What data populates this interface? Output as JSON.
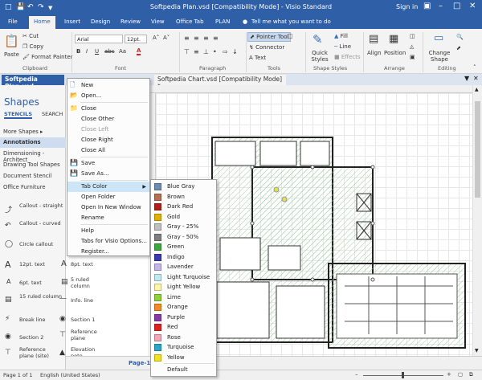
{
  "titlebar": {
    "title": "Softpedia Plan.vsd  [Compatibility Mode] - Visio Standard",
    "signin": "Sign in",
    "save_icon": "save-icon",
    "undo_icon": "undo-icon",
    "redo_icon": "redo-icon",
    "minimize_icon": "minimize-icon",
    "restore_icon": "restore-icon",
    "close_icon": "close-icon",
    "options_icon": "ribbon-options-icon"
  },
  "ribbon_tabs": [
    "File",
    "Home",
    "Insert",
    "Design",
    "Review",
    "View",
    "Office Tab",
    "PLAN"
  ],
  "tell_me": "Tell me what you want to do",
  "ribbon": {
    "clipboard": {
      "paste": "Paste",
      "cut": "Cut",
      "copy": "Copy",
      "format_painter": "Format Painter",
      "label": "Clipboard"
    },
    "font": {
      "name": "Arial",
      "size": "12pt.",
      "bold": "B",
      "italic": "I",
      "underline": "U",
      "strike": "abc",
      "case": "Aa",
      "font_color": "A",
      "label": "Font"
    },
    "paragraph": {
      "label": "Paragraph"
    },
    "tools": {
      "pointer": "Pointer Tool",
      "connector": "Connector",
      "text": "Text",
      "label": "Tools"
    },
    "shape_styles": {
      "quick_styles": "Quick Styles",
      "fill": "Fill",
      "line": "Line",
      "effects": "Effects",
      "label": "Shape Styles"
    },
    "arrange": {
      "align": "Align",
      "position": "Position",
      "label": "Arrange"
    },
    "editing": {
      "change_shape": "Change Shape",
      "label": "Editing"
    }
  },
  "doc_tabs": [
    {
      "label": "Softpedia Plan.vsd"
    },
    {
      "label": "Softpedia Chart.vsd  [Compatibility Mode] *"
    }
  ],
  "shapes_panel": {
    "title": "Shapes",
    "stencils": "STENCILS",
    "search": "SEARCH",
    "more_shapes": "More Shapes",
    "stencil_list": [
      "Annotations",
      "Dimensioning - Architect",
      "Drawing Tool Shapes",
      "Document Stencil",
      "Office Furniture"
    ],
    "items": [
      {
        "label": "Callout - straight",
        "icon": "callout-straight-icon"
      },
      {
        "label": "Callout - curved",
        "icon": "callout-curved-icon"
      },
      {
        "label": "Circle callout",
        "icon": "circle-callout-icon"
      },
      {
        "label": "12pt. text",
        "icon": "text-12pt-icon"
      },
      {
        "label": "8pt. text",
        "icon": "text-8pt-icon"
      },
      {
        "label": "6pt. text",
        "icon": "text-6pt-icon"
      },
      {
        "label": "5 ruled column",
        "icon": "ruled-column-5-icon"
      },
      {
        "label": "15 ruled column",
        "icon": "ruled-column-15-icon"
      },
      {
        "label": "Info. line",
        "icon": "info-line-icon"
      },
      {
        "label": "Break line",
        "icon": "break-line-icon"
      },
      {
        "label": "Section 1",
        "icon": "section-1-icon"
      },
      {
        "label": "Section 2",
        "icon": "section-2-icon"
      },
      {
        "label": "Reference plane",
        "icon": "reference-plane-icon"
      },
      {
        "label": "Reference plane (site)",
        "icon": "reference-plane-site-icon"
      },
      {
        "label": "Elevation note",
        "icon": "elevation-note-icon"
      }
    ]
  },
  "page_bar": {
    "page": "Page-1"
  },
  "status": {
    "page": "Page 1 of 1",
    "language": "English (United States)"
  },
  "context_menu": {
    "items": [
      {
        "label": "New",
        "icon": "new-file-icon",
        "disabled": false
      },
      {
        "label": "Open...",
        "icon": "open-file-icon",
        "disabled": false
      },
      {
        "sep": true
      },
      {
        "label": "Close",
        "icon": "folder-close-icon",
        "disabled": false
      },
      {
        "label": "Close Other",
        "disabled": false
      },
      {
        "label": "Close Left",
        "disabled": true
      },
      {
        "label": "Close Right",
        "disabled": false
      },
      {
        "label": "Close All",
        "disabled": false
      },
      {
        "sep": true
      },
      {
        "label": "Save",
        "icon": "save-icon",
        "disabled": false
      },
      {
        "label": "Save As...",
        "icon": "save-as-icon",
        "disabled": false
      },
      {
        "sep": true
      },
      {
        "label": "Tab Color",
        "disabled": false,
        "highlight": true,
        "submenu": true
      },
      {
        "label": "Open Folder",
        "disabled": false
      },
      {
        "label": "Open In New Window",
        "disabled": false
      },
      {
        "label": "Rename",
        "disabled": false
      },
      {
        "sep": true
      },
      {
        "label": "Help",
        "disabled": false
      },
      {
        "label": "Tabs for Visio Options...",
        "disabled": false
      },
      {
        "label": "Register...",
        "disabled": false
      }
    ]
  },
  "tab_color_menu": {
    "items": [
      {
        "label": "Blue Gray",
        "color": "#6d8bb1"
      },
      {
        "label": "Brown",
        "color": "#b5704f"
      },
      {
        "label": "Dark Red",
        "color": "#b2201c"
      },
      {
        "label": "Gold",
        "color": "#e0b000"
      },
      {
        "label": "Gray - 25%",
        "color": "#bfbfbf"
      },
      {
        "label": "Gray - 50%",
        "color": "#7f7f7f"
      },
      {
        "label": "Green",
        "color": "#3aa83a"
      },
      {
        "label": "Indigo",
        "color": "#3a3ab0"
      },
      {
        "label": "Lavender",
        "color": "#c3b6e8"
      },
      {
        "label": "Light Turquoise",
        "color": "#bfeaf2"
      },
      {
        "label": "Light Yellow",
        "color": "#fff5a8"
      },
      {
        "label": "Lime",
        "color": "#8fd13a"
      },
      {
        "label": "Orange",
        "color": "#f38b1e"
      },
      {
        "label": "Purple",
        "color": "#8a3aa8"
      },
      {
        "label": "Red",
        "color": "#e02020"
      },
      {
        "label": "Rose",
        "color": "#f2a6b8"
      },
      {
        "label": "Turquoise",
        "color": "#2aa6c8"
      },
      {
        "label": "Yellow",
        "color": "#f5e21e"
      },
      {
        "sep": true
      },
      {
        "label": "Default"
      }
    ]
  }
}
